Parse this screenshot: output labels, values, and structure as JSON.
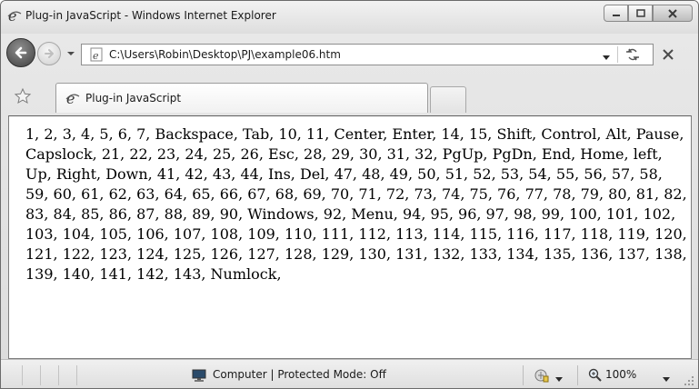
{
  "window": {
    "title": "Plug-in JavaScript - Windows Internet Explorer",
    "minimize_label": "",
    "maximize_label": "",
    "close_label": ""
  },
  "address": {
    "url": "C:\\Users\\Robin\\Desktop\\PJ\\example06.htm"
  },
  "tabs": [
    {
      "label": "Plug-in JavaScript"
    }
  ],
  "page": {
    "text": "1, 2, 3, 4, 5, 6, 7, Backspace, Tab, 10, 11, Center, Enter, 14, 15, Shift, Control, Alt, Pause, Capslock, 21, 22, 23, 24, 25, 26, Esc, 28, 29, 30, 31, 32, PgUp, PgDn, End, Home, left, Up, Right, Down, 41, 42, 43, 44, Ins, Del, 47, 48, 49, 50, 51, 52, 53, 54, 55, 56, 57, 58, 59, 60, 61, 62, 63, 64, 65, 66, 67, 68, 69, 70, 71, 72, 73, 74, 75, 76, 77, 78, 79, 80, 81, 82, 83, 84, 85, 86, 87, 88, 89, 90, Windows, 92, Menu, 94, 95, 96, 97, 98, 99, 100, 101, 102, 103, 104, 105, 106, 107, 108, 109, 110, 111, 112, 113, 114, 115, 116, 117, 118, 119, 120, 121, 122, 123, 124, 125, 126, 127, 128, 129, 130, 131, 132, 133, 134, 135, 136, 137, 138, 139, 140, 141, 142, 143, Numlock,"
  },
  "statusbar": {
    "zone": "Computer | Protected Mode: Off",
    "zoom": "100%"
  },
  "icons": {
    "title": "ie-logo-icon",
    "back": "back-arrow-icon",
    "forward": "forward-arrow-icon",
    "favorites": "favorites-star-icon",
    "computer": "computer-icon",
    "zoom": "zoom-icon"
  }
}
